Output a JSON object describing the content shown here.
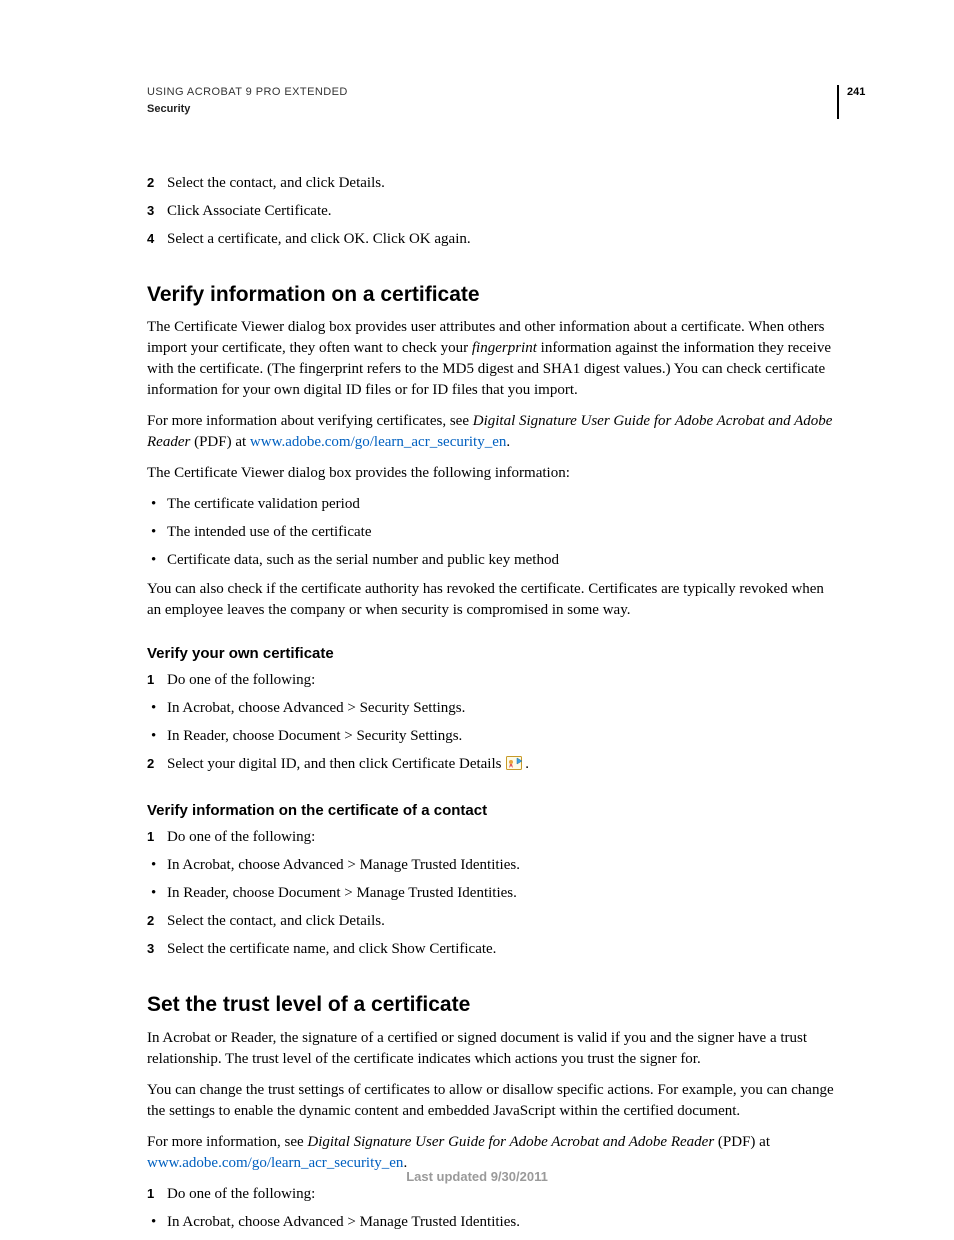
{
  "header": {
    "running_head": "USING ACROBAT 9 PRO EXTENDED",
    "section_label": "Security",
    "page_number": "241"
  },
  "intro_steps": [
    {
      "n": "2",
      "text": "Select the contact, and click Details."
    },
    {
      "n": "3",
      "text": "Click Associate Certificate."
    },
    {
      "n": "4",
      "text": "Select a certificate, and click OK. Click OK again."
    }
  ],
  "sec1": {
    "title": "Verify information on a certificate",
    "p1a": "The Certificate Viewer dialog box provides user attributes and other information about a certificate. When others import your certificate, they often want to check your ",
    "p1b_italic": "fingerprint",
    "p1c": " information against the information they receive with the certificate. (The fingerprint refers to the MD5 digest and SHA1 digest values.) You can check certificate information for your own digital ID files or for ID files that you import.",
    "p2a": "For more information about verifying certificates, see ",
    "p2b_italic": "Digital Signature User Guide for Adobe Acrobat and Adobe Reader",
    "p2c": " (PDF) at ",
    "p2_link": "www.adobe.com/go/learn_acr_security_en",
    "p2d": ".",
    "p3": "The Certificate Viewer dialog box provides the following information:",
    "bullets": [
      "The certificate validation period",
      "The intended use of the certificate",
      "Certificate data, such as the serial number and public key method"
    ],
    "p4": "You can also check if the certificate authority has revoked the certificate. Certificates are typically revoked when an employee leaves the company or when security is compromised in some way."
  },
  "sec1a": {
    "title": "Verify your own certificate",
    "rows": [
      {
        "type": "num",
        "n": "1",
        "text": "Do one of the following:"
      },
      {
        "type": "bul",
        "text": "In Acrobat, choose Advanced > Security Settings."
      },
      {
        "type": "bul",
        "text": "In Reader, choose Document > Security Settings."
      },
      {
        "type": "num",
        "n": "2",
        "text": "Select your digital ID, and then click Certificate Details",
        "icon": true,
        "text_after": "."
      }
    ]
  },
  "sec1b": {
    "title": "Verify information on the certificate of a contact",
    "rows": [
      {
        "type": "num",
        "n": "1",
        "text": "Do one of the following:"
      },
      {
        "type": "bul",
        "text": "In Acrobat, choose Advanced > Manage Trusted Identities."
      },
      {
        "type": "bul",
        "text": "In Reader, choose Document > Manage Trusted Identities."
      },
      {
        "type": "num",
        "n": "2",
        "text": "Select the contact, and click Details."
      },
      {
        "type": "num",
        "n": "3",
        "text": "Select the certificate name, and click Show Certificate."
      }
    ]
  },
  "sec2": {
    "title": "Set the trust level of a certificate",
    "p1": "In Acrobat or Reader, the signature of a certified or signed document is valid if you and the signer have a trust relationship. The trust level of the certificate indicates which actions you trust the signer for.",
    "p2": "You can change the trust settings of certificates to allow or disallow specific actions. For example, you can change the settings to enable the dynamic content and embedded JavaScript within the certified document.",
    "p3a": "For more information, see ",
    "p3b_italic": "Digital Signature User Guide for Adobe Acrobat and Adobe Reader",
    "p3c": " (PDF) at ",
    "p3_link": "www.adobe.com/go/learn_acr_security_en",
    "p3d": ".",
    "rows": [
      {
        "type": "num",
        "n": "1",
        "text": "Do one of the following:"
      },
      {
        "type": "bul",
        "text": "In Acrobat, choose Advanced > Manage Trusted Identities."
      }
    ]
  },
  "footer": {
    "text": "Last updated 9/30/2011"
  },
  "glyphs": {
    "bullet": "•"
  }
}
